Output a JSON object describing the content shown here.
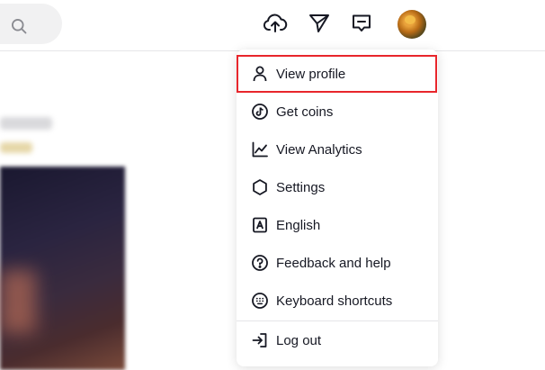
{
  "header": {
    "search_icon": "search-icon",
    "upload_icon": "upload-cloud-icon",
    "send_icon": "paper-plane-icon",
    "inbox_icon": "message-inbox-icon",
    "avatar": "user-avatar"
  },
  "menu": {
    "items": [
      {
        "label": "View profile",
        "icon": "person-icon"
      },
      {
        "label": "Get coins",
        "icon": "tiktok-coin-icon"
      },
      {
        "label": "View Analytics",
        "icon": "analytics-chart-icon"
      },
      {
        "label": "Settings",
        "icon": "gear-icon"
      },
      {
        "label": "English",
        "icon": "language-icon"
      },
      {
        "label": "Feedback and help",
        "icon": "help-icon"
      },
      {
        "label": "Keyboard shortcuts",
        "icon": "keyboard-icon"
      },
      {
        "label": "Log out",
        "icon": "logout-icon"
      }
    ],
    "highlighted_item": "View profile"
  },
  "colors": {
    "highlight_border": "#e8262c",
    "text": "#161823"
  }
}
